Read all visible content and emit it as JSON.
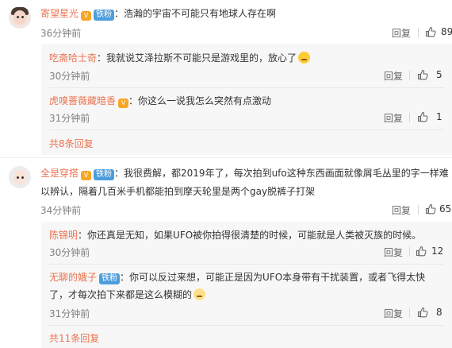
{
  "comments": [
    {
      "user": "寄望星光",
      "crown": "V",
      "fan_badge": "铁粉",
      "text": "浩瀚的宇宙不可能只有地球人存在啊",
      "time": "36分钟前",
      "reply_label": "回复",
      "likes": "89",
      "replies": [
        {
          "user": "吃斋哈士奇",
          "text": "我就说艾泽拉斯不可能只是游戏里的，放心了",
          "time": "30分钟前",
          "reply_label": "回复",
          "likes": "5"
        },
        {
          "user": "虎嗅蔷薇藏暗香",
          "crown": "V",
          "text": "你这么一说我怎么突然有点激动",
          "time": "31分钟前",
          "reply_label": "回复",
          "likes": "1"
        }
      ],
      "more_label": "共8条回复"
    },
    {
      "user": "全是穿搭",
      "crown": "V",
      "fan_badge": "铁粉",
      "text_line1": "我很费解，都2019年了，每次拍到ufo这种东西画面就像屑毛丛里的字一样难",
      "text_line2": "以辨认，隔着几百米手机都能拍到摩天轮里是两个gay脱裤子打架",
      "time": "34分钟前",
      "reply_label": "回复",
      "likes": "65",
      "replies": [
        {
          "user": "陈锦明",
          "text": "你还真是无知，如果UFO被你拍得很清楚的时候，可能就是人类被灭族的时候。",
          "time": "30分钟前",
          "reply_label": "回复",
          "likes": "12"
        },
        {
          "user": "无聊的娥子",
          "fan_badge": "铁粉",
          "text_line1": "你可以反过来想，可能正是因为UFO本身带有干扰装置，或者飞得太快",
          "text_line2": "了，才每次拍下来都是这么模糊的",
          "time": "31分钟前",
          "reply_label": "回复",
          "likes": "8"
        }
      ],
      "more_label": "共11条回复"
    }
  ],
  "colors": {
    "username": "#eb7350",
    "fan_badge": "#4e9ddb",
    "crown": "#f7a626",
    "subbox_bg": "#f7f7f7"
  },
  "icons": {
    "like": "thumbs-up-icon",
    "crown": "crown-icon",
    "emoji": "smile-emoji-icon"
  }
}
